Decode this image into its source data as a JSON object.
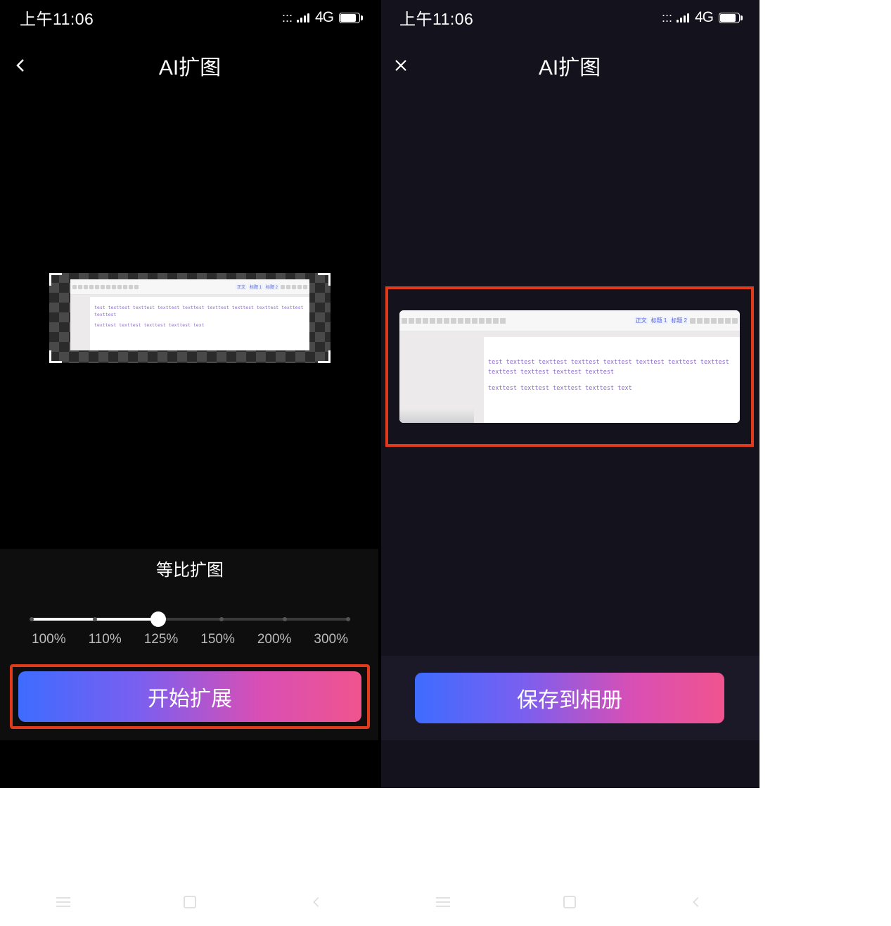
{
  "status": {
    "time": "上午11:06",
    "network": "4G",
    "signal_icon": "signal-icon",
    "battery_icon": "battery-icon"
  },
  "left": {
    "header": {
      "title": "AI扩图",
      "back_icon": "back-icon"
    },
    "document_preview": {
      "line1": "test texttest texttest texttest texttest texttest texttest texttest texttest texttest",
      "line2": "texttest texttest texttest texttest text",
      "toolbar_tags": [
        "正文",
        "标题 1",
        "标题 2"
      ]
    },
    "panel": {
      "title": "等比扩图",
      "ticks": [
        "100%",
        "110%",
        "125%",
        "150%",
        "200%",
        "300%"
      ],
      "value_index": 2
    },
    "primary_button": "开始扩展"
  },
  "right": {
    "header": {
      "title": "AI扩图",
      "close_icon": "close-icon"
    },
    "document_preview": {
      "line1": "test texttest texttest texttest texttest texttest texttest texttest texttest texttest texttest texttest",
      "line2": "texttest texttest texttest texttest text",
      "toolbar_tags": [
        "正文",
        "标题 1",
        "标题 2"
      ]
    },
    "primary_button": "保存到相册"
  },
  "android_nav": {
    "recent_icon": "hamburger-icon",
    "home_icon": "square-icon",
    "back_icon": "chevron-left-icon"
  }
}
